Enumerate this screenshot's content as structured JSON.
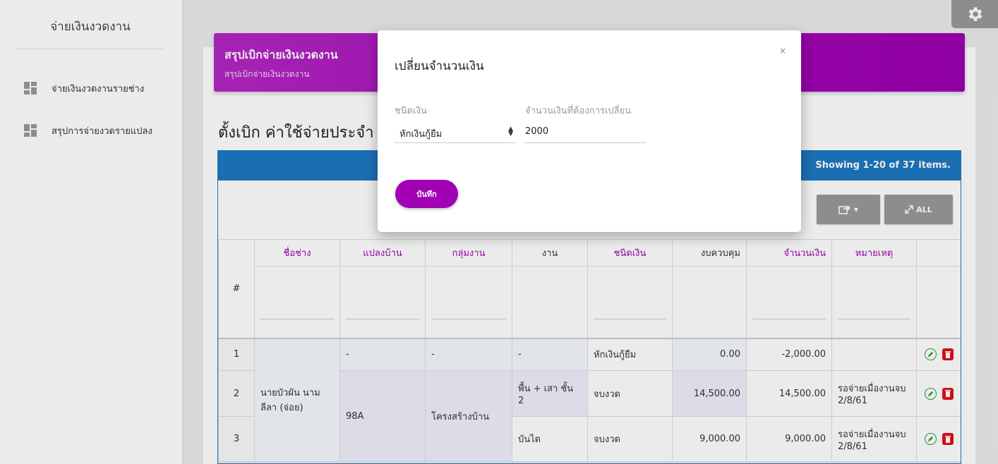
{
  "sidebar": {
    "title": "จ่ายเงินงวดงาน",
    "items": [
      {
        "label": "จ่ายเงินงวดงานรายช่าง",
        "icon": "dashboard-icon"
      },
      {
        "label": "สรุปการจ่ายงวดรายแปลง",
        "icon": "dashboard-icon"
      }
    ]
  },
  "settings": {
    "icon": "gear-icon"
  },
  "banner": {
    "title": "สรุปเบิกจ่ายเงินงวดงาน",
    "subtitle": "สรุปเบิกจ่ายเงินงวดงาน"
  },
  "page": {
    "heading": "ตั้งเบิก ค่าใช้จ่ายประจำ"
  },
  "grid": {
    "showing": "Showing 1-20 of 37 items.",
    "export_icon": "share-icon",
    "all_label": "ALL",
    "headers": [
      "#",
      "ชื่อช่าง",
      "แปลงบ้าน",
      "กลุ่มงาน",
      "งาน",
      "ชนิดเงิน",
      "งบควบคุม",
      "จำนวนเงิน",
      "หมายเหตุ"
    ],
    "worker": "นายบัวผัน นามลีลา (จ่อย)",
    "plot_merged": "98A",
    "group_merged": "โครงสร้างบ้าน",
    "rows": [
      {
        "no": "1",
        "plot": "-",
        "group": "-",
        "job": "-",
        "money_type": "หักเงินกู้ยืม",
        "budget": "0.00",
        "amount": "-2,000.00",
        "note": ""
      },
      {
        "no": "2",
        "job": "พื้น + เสา ชั้น 2",
        "money_type": "จบงวด",
        "budget": "14,500.00",
        "amount": "14,500.00",
        "note": "รอจ่ายเมื่องานจบ 2/8/61"
      },
      {
        "no": "3",
        "job": "บันได",
        "money_type": "จบงวด",
        "budget": "9,000.00",
        "amount": "9,000.00",
        "note": "รอจ่ายเมื่องานจบ 2/8/61"
      }
    ]
  },
  "modal": {
    "title": "เปลี่ยนจำนวนเงิน",
    "close": "×",
    "money_type_label": "ชนิดเงิน",
    "money_type_value": "หักเงินกู้ยืม",
    "amount_label": "จำนวนเงินที่ต้องการเปลี่ยน",
    "amount_value": "2000",
    "save_label": "บันทึก"
  },
  "colors": {
    "accent": "#a100b5",
    "grid_header": "#1e78c2",
    "edit": "#2e9e3a",
    "delete": "#e2101a"
  }
}
